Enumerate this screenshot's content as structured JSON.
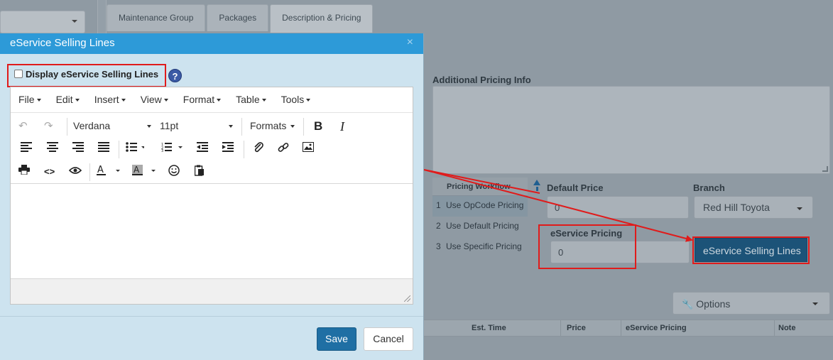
{
  "background": {
    "tabs": [
      "Maintenance Group",
      "Packages",
      "Description & Pricing"
    ],
    "additional_pricing_label": "Additional Pricing Info",
    "pricing_workflow": {
      "header": "Pricing Workflow",
      "rows": [
        {
          "num": "1",
          "label": "Use OpCode Pricing"
        },
        {
          "num": "2",
          "label": "Use Default Pricing"
        },
        {
          "num": "3",
          "label": "Use Specific Pricing"
        }
      ]
    },
    "default_price_label": "Default Price",
    "default_price_value": "0",
    "branch_label": "Branch",
    "branch_value": "Red Hill Toyota",
    "eservice_pricing_label": "eService Pricing",
    "eservice_pricing_value": "0",
    "eservice_lines_button": "eService Selling Lines",
    "options_button": "Options",
    "grid_columns": [
      "Est. Time",
      "Price",
      "eService Pricing",
      "Note"
    ]
  },
  "modal": {
    "title": "eService Selling Lines",
    "close": "×",
    "display_checkbox_label": "Display eService Selling Lines",
    "display_checked": false,
    "help": "?",
    "menus": [
      "File",
      "Edit",
      "Insert",
      "View",
      "Format",
      "Table",
      "Tools"
    ],
    "font_family": "Verdana",
    "font_size": "11pt",
    "formats_label": "Formats",
    "save_label": "Save",
    "cancel_label": "Cancel"
  },
  "colors": {
    "modal_header": "#2d9ad8",
    "annotation_red": "#e01b1b",
    "primary_button": "#1f6fa4"
  }
}
